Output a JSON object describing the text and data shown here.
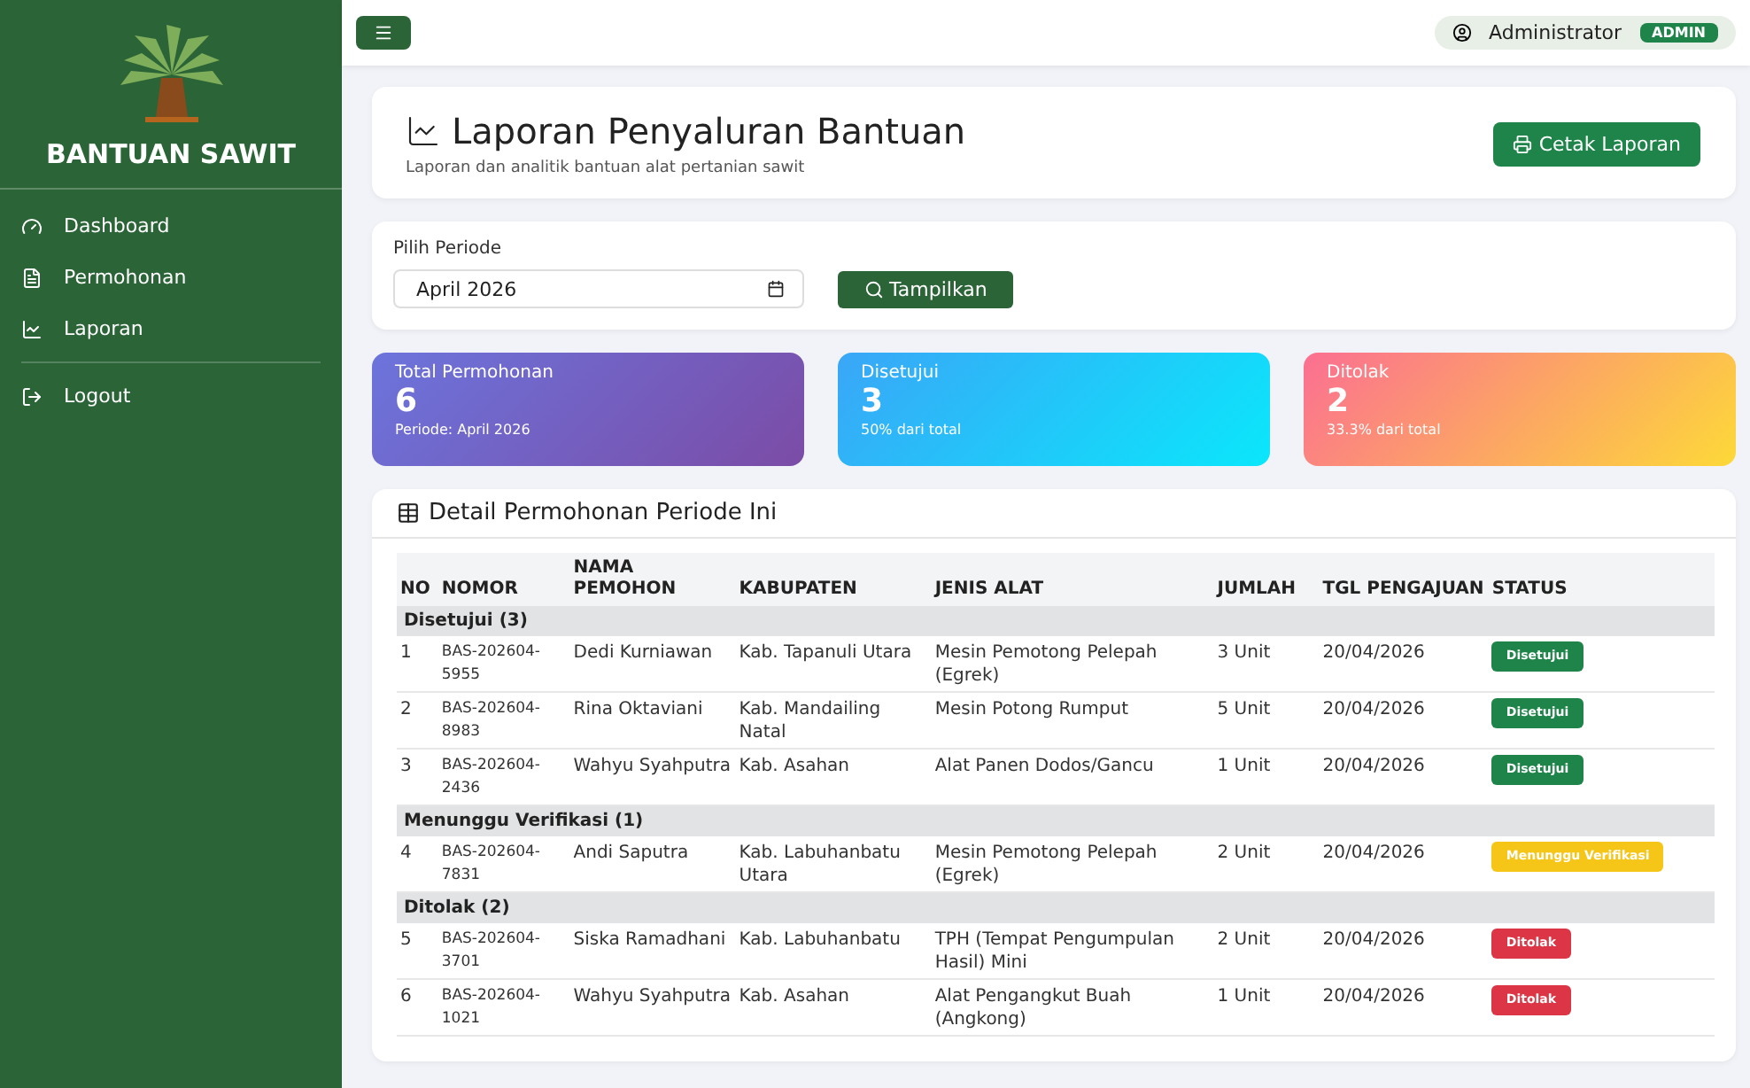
{
  "sidebar": {
    "brand": "BANTUAN SAWIT",
    "items": [
      {
        "label": "Dashboard"
      },
      {
        "label": "Permohonan"
      },
      {
        "label": "Laporan"
      },
      {
        "label": "Logout"
      }
    ]
  },
  "topbar": {
    "user": "Administrator",
    "role": "ADMIN"
  },
  "header": {
    "title": "Laporan Penyaluran Bantuan",
    "subtitle": "Laporan dan analitik bantuan alat pertanian sawit",
    "print_button": "Cetak Laporan"
  },
  "filter": {
    "label": "Pilih Periode",
    "value": "April 2026",
    "button": "Tampilkan"
  },
  "stats": [
    {
      "kind": "total",
      "label": "Total Permohonan",
      "value": "6",
      "note": "Periode: April 2026"
    },
    {
      "kind": "approved",
      "label": "Disetujui",
      "value": "3",
      "note": "50% dari total"
    },
    {
      "kind": "rejected",
      "label": "Ditolak",
      "value": "2",
      "note": "33.3% dari total"
    }
  ],
  "table": {
    "title": "Detail Permohonan Periode Ini",
    "columns": [
      "NO",
      "NOMOR",
      "NAMA PEMOHON",
      "KABUPATEN",
      "JENIS ALAT",
      "JUMLAH",
      "TGL PENGAJUAN",
      "STATUS"
    ],
    "groups": [
      {
        "label": "Disetujui (3)",
        "rows": [
          {
            "no": "1",
            "nomor": "BAS-202604-5955",
            "nama": "Dedi Kurniawan",
            "kabupaten": "Kab. Tapanuli Utara",
            "jenis": "Mesin Pemotong Pelepah (Egrek)",
            "jumlah": "3 Unit",
            "tgl": "20/04/2026",
            "status": {
              "label": "Disetujui",
              "kind": "approved"
            }
          },
          {
            "no": "2",
            "nomor": "BAS-202604-8983",
            "nama": "Rina Oktaviani",
            "kabupaten": "Kab. Mandailing Natal",
            "jenis": "Mesin Potong Rumput",
            "jumlah": "5 Unit",
            "tgl": "20/04/2026",
            "status": {
              "label": "Disetujui",
              "kind": "approved"
            }
          },
          {
            "no": "3",
            "nomor": "BAS-202604-2436",
            "nama": "Wahyu Syahputra",
            "kabupaten": "Kab. Asahan",
            "jenis": "Alat Panen Dodos/Gancu",
            "jumlah": "1 Unit",
            "tgl": "20/04/2026",
            "status": {
              "label": "Disetujui",
              "kind": "approved"
            }
          }
        ]
      },
      {
        "label": "Menunggu Verifikasi (1)",
        "rows": [
          {
            "no": "4",
            "nomor": "BAS-202604-7831",
            "nama": "Andi Saputra",
            "kabupaten": "Kab. Labuhanbatu Utara",
            "jenis": "Mesin Pemotong Pelepah (Egrek)",
            "jumlah": "2 Unit",
            "tgl": "20/04/2026",
            "status": {
              "label": "Menunggu Verifikasi",
              "kind": "pending"
            }
          }
        ]
      },
      {
        "label": "Ditolak (2)",
        "rows": [
          {
            "no": "5",
            "nomor": "BAS-202604-3701",
            "nama": "Siska Ramadhani",
            "kabupaten": "Kab. Labuhanbatu",
            "jenis": "TPH (Tempat Pengumpulan Hasil) Mini",
            "jumlah": "2 Unit",
            "tgl": "20/04/2026",
            "status": {
              "label": "Ditolak",
              "kind": "rejected"
            }
          },
          {
            "no": "6",
            "nomor": "BAS-202604-1021",
            "nama": "Wahyu Syahputra",
            "kabupaten": "Kab. Asahan",
            "jenis": "Alat Pengangkut Buah (Angkong)",
            "jumlah": "1 Unit",
            "tgl": "20/04/2026",
            "status": {
              "label": "Ditolak",
              "kind": "rejected"
            }
          }
        ]
      }
    ]
  }
}
